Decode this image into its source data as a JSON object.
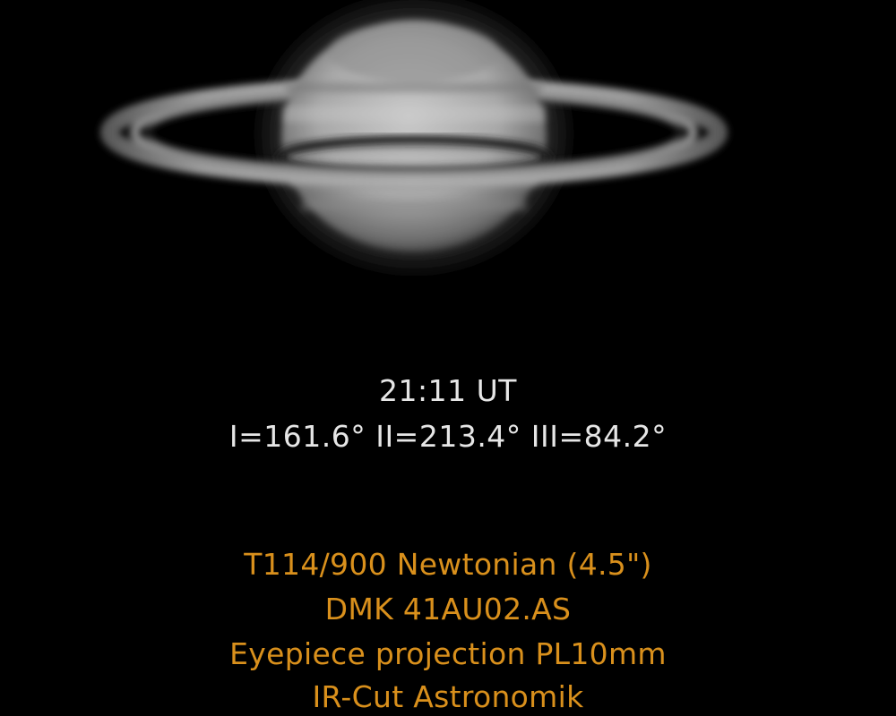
{
  "image": {
    "subject": "Saturn",
    "background_color": "#000000",
    "planet_tone": "#bdbdbd",
    "observation_text_color": "#e6e6e6",
    "equipment_text_color": "#d9901c"
  },
  "observation": {
    "time": "21:11 UT",
    "longitudes": "I=161.6° II=213.4° III=84.2°"
  },
  "equipment": {
    "telescope": "T114/900 Newtonian (4.5\")",
    "camera": "DMK 41AU02.AS",
    "method": "Eyepiece projection PL10mm",
    "filter": "IR-Cut Astronomik"
  }
}
